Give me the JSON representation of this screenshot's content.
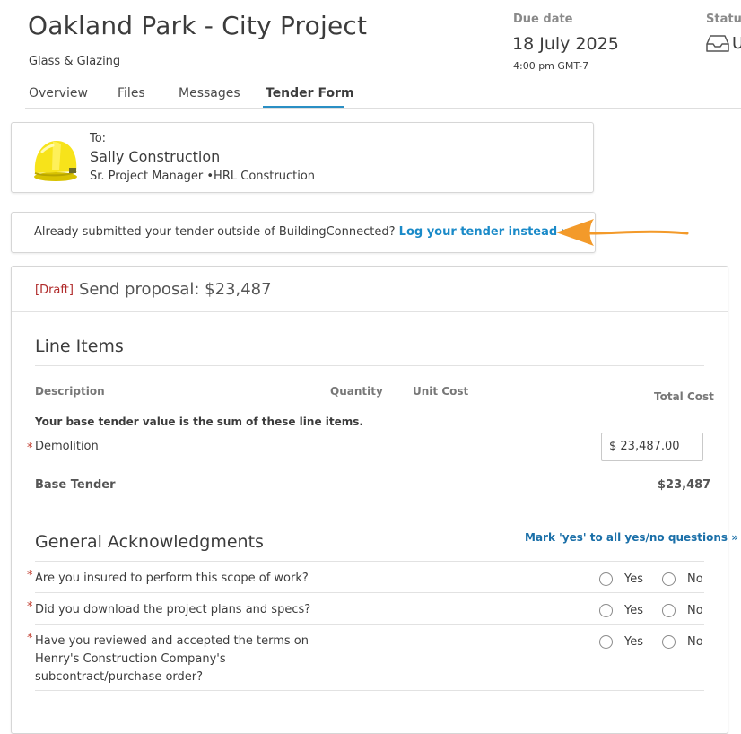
{
  "project": {
    "title": "Oakland Park - City Project",
    "trade": "Glass & Glazing"
  },
  "due": {
    "label": "Due date",
    "date": "18 July 2025",
    "time": "4:00 pm GMT-7"
  },
  "status": {
    "label": "Status",
    "value": "U",
    "icon": "inbox-tray-icon"
  },
  "tabs": [
    {
      "label": "Overview",
      "active": false
    },
    {
      "label": "Files",
      "active": false
    },
    {
      "label": "Messages",
      "active": false
    },
    {
      "label": "Tender Form",
      "active": true
    }
  ],
  "recipient": {
    "to_label": "To:",
    "name": "Sally Construction",
    "role": "Sr. Project Manager •HRL Construction",
    "avatar_icon": "hard-hat-icon"
  },
  "notice": {
    "text": "Already submitted your tender outside of BuildingConnected?",
    "link": "Log your tender instead »",
    "accent": "#f39a2a"
  },
  "proposal": {
    "draft_tag": "[Draft]",
    "title": "Send proposal: $23,487"
  },
  "line_items": {
    "section_title": "Line Items",
    "columns": {
      "description": "Description",
      "quantity": "Quantity",
      "unit_cost": "Unit Cost",
      "total_cost": "Total Cost"
    },
    "note": "Your base tender value is the sum of these line items.",
    "items": [
      {
        "required": "*",
        "label": "Demolition",
        "value": "$ 23,487.00"
      }
    ],
    "base_label": "Base Tender",
    "base_value": "$23,487"
  },
  "acknowledgments": {
    "section_title": "General Acknowledgments",
    "mark_all": "Mark 'yes' to all yes/no questions »",
    "yes_label": "Yes",
    "no_label": "No",
    "questions": [
      {
        "required": "*",
        "text": "Are you insured to perform this scope of work?"
      },
      {
        "required": "*",
        "text": "Did you download the project plans and specs?"
      },
      {
        "required": "*",
        "text": "Have you reviewed and accepted the terms on Henry's Construction Company's subcontract/purchase order?"
      }
    ]
  },
  "colors": {
    "link": "#1a8ac8",
    "tab_underline": "#2a8fc4",
    "draft": "#b02a2a",
    "required": "#c0392b"
  }
}
